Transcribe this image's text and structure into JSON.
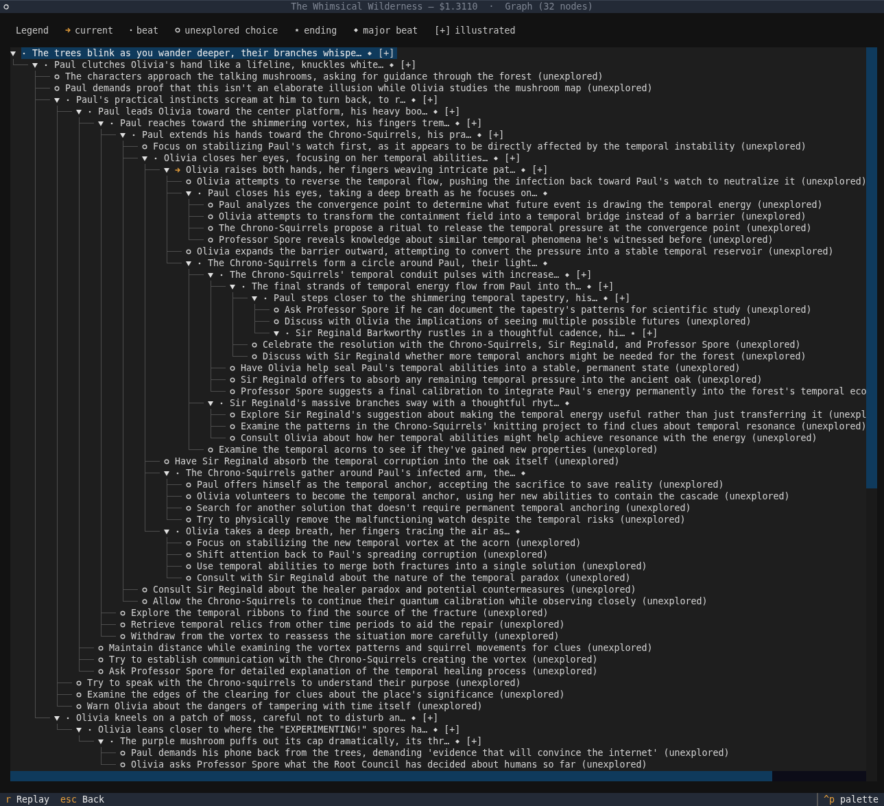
{
  "window": {
    "title": "The Whimsical Wilderness — $1.3110  ·  Graph (32 nodes)"
  },
  "legend": {
    "label": "Legend",
    "items": [
      {
        "kind": "current",
        "label": "current"
      },
      {
        "kind": "beat",
        "label": "beat"
      },
      {
        "kind": "choice",
        "label": "unexplored choice"
      },
      {
        "kind": "ending",
        "label": "ending"
      },
      {
        "kind": "major",
        "label": "major beat"
      },
      {
        "kind": "illustrated",
        "symbol": "[+]",
        "label": "illustrated"
      }
    ]
  },
  "tree": [
    {
      "kind": "beat",
      "expanded": true,
      "selected": true,
      "text": "The trees blink as you wander deeper, their branches whispe…",
      "major": true,
      "badge": "[+]",
      "children": [
        {
          "kind": "beat",
          "expanded": true,
          "selected": false,
          "text": "Paul clutches Olivia's hand like a lifeline, knuckles white…",
          "major": true,
          "badge": "[+]",
          "children": [
            {
              "kind": "choice",
              "selected": false,
              "text": "The characters approach the talking mushrooms, asking for guidance through the forest (unexplored)"
            },
            {
              "kind": "choice",
              "selected": false,
              "text": "Paul demands proof that this isn't an elaborate illusion while Olivia studies the mushroom map (unexplored)"
            },
            {
              "kind": "beat",
              "expanded": true,
              "selected": false,
              "text": "Paul's practical instincts scream at him to turn back, to r…",
              "major": true,
              "badge": "[+]",
              "children": [
                {
                  "kind": "beat",
                  "expanded": true,
                  "selected": false,
                  "text": "Paul leads Olivia toward the center platform, his heavy boo…",
                  "major": true,
                  "badge": "[+]",
                  "children": [
                    {
                      "kind": "beat",
                      "expanded": true,
                      "selected": false,
                      "text": "Paul reaches toward the shimmering vortex, his fingers trem…",
                      "major": true,
                      "badge": "[+]",
                      "children": [
                        {
                          "kind": "beat",
                          "expanded": true,
                          "selected": false,
                          "text": "Paul extends his hands toward the Chrono-Squirrels, his pra…",
                          "major": true,
                          "badge": "[+]",
                          "children": [
                            {
                              "kind": "choice",
                              "selected": false,
                              "text": "Focus on stabilizing Paul's watch first, as it appears to be directly affected by the temporal instability (unexplored)"
                            },
                            {
                              "kind": "beat",
                              "expanded": true,
                              "selected": false,
                              "text": "Olivia closes her eyes, focusing on her temporal abilities…",
                              "major": true,
                              "badge": "[+]",
                              "children": [
                                {
                                  "kind": "current",
                                  "expanded": true,
                                  "selected": false,
                                  "text": "Olivia raises both hands, her fingers weaving intricate pat…",
                                  "major": true,
                                  "badge": "[+]",
                                  "children": [
                                    {
                                      "kind": "choice",
                                      "selected": false,
                                      "text": "Olivia attempts to reverse the temporal flow, pushing the infection back toward Paul's watch to neutralize it (unexplored)"
                                    },
                                    {
                                      "kind": "beat",
                                      "expanded": true,
                                      "selected": false,
                                      "text": "Paul closes his eyes, taking a deep breath as he focuses on…",
                                      "major": true,
                                      "children": [
                                        {
                                          "kind": "choice",
                                          "selected": false,
                                          "text": "Paul analyzes the convergence point to determine what future event is drawing the temporal energy (unexplored)"
                                        },
                                        {
                                          "kind": "choice",
                                          "selected": false,
                                          "text": "Olivia attempts to transform the containment field into a temporal bridge instead of a barrier (unexplored)"
                                        },
                                        {
                                          "kind": "choice",
                                          "selected": false,
                                          "text": "The Chrono-Squirrels propose a ritual to release the temporal pressure at the convergence point (unexplored)"
                                        },
                                        {
                                          "kind": "choice",
                                          "selected": false,
                                          "text": "Professor Spore reveals knowledge about similar temporal phenomena he's witnessed before (unexplored)"
                                        }
                                      ]
                                    },
                                    {
                                      "kind": "choice",
                                      "selected": false,
                                      "text": "Olivia expands the barrier outward, attempting to convert the pressure into a stable temporal reservoir (unexplored)"
                                    },
                                    {
                                      "kind": "beat",
                                      "expanded": true,
                                      "selected": false,
                                      "text": "The Chrono-Squirrels form a circle around Paul, their light…",
                                      "major": true,
                                      "children": [
                                        {
                                          "kind": "beat",
                                          "expanded": true,
                                          "selected": false,
                                          "text": "The Chrono-Squirrels' temporal conduit pulses with increase…",
                                          "major": true,
                                          "badge": "[+]",
                                          "children": [
                                            {
                                              "kind": "beat",
                                              "expanded": true,
                                              "selected": false,
                                              "text": "The final strands of temporal energy flow from Paul into th…",
                                              "major": true,
                                              "badge": "[+]",
                                              "children": [
                                                {
                                                  "kind": "beat",
                                                  "expanded": true,
                                                  "selected": false,
                                                  "text": "Paul steps closer to the shimmering temporal tapestry, his…",
                                                  "major": true,
                                                  "badge": "[+]",
                                                  "children": [
                                                    {
                                                      "kind": "choice",
                                                      "selected": false,
                                                      "text": "Ask Professor Spore if he can document the tapestry's patterns for scientific study (unexplored)"
                                                    },
                                                    {
                                                      "kind": "choice",
                                                      "selected": false,
                                                      "text": "Discuss with Olivia the implications of seeing multiple possible futures (unexplored)"
                                                    },
                                                    {
                                                      "kind": "beat",
                                                      "expanded": true,
                                                      "selected": false,
                                                      "text": "Sir Reginald Barkworthy rustles in a thoughtful cadence, hi…",
                                                      "ending": true,
                                                      "badge": "[+]"
                                                    }
                                                  ]
                                                },
                                                {
                                                  "kind": "choice",
                                                  "selected": false,
                                                  "text": "Celebrate the resolution with the Chrono-Squirrels, Sir Reginald, and Professor Spore (unexplored)"
                                                },
                                                {
                                                  "kind": "choice",
                                                  "selected": false,
                                                  "text": "Discuss with Sir Reginald whether more temporal anchors might be needed for the forest (unexplored)"
                                                }
                                              ]
                                            },
                                            {
                                              "kind": "choice",
                                              "selected": false,
                                              "text": "Have Olivia help seal Paul's temporal abilities into a stable, permanent state (unexplored)"
                                            },
                                            {
                                              "kind": "choice",
                                              "selected": false,
                                              "text": "Sir Reginald offers to absorb any remaining temporal pressure into the ancient oak (unexplored)"
                                            },
                                            {
                                              "kind": "choice",
                                              "selected": false,
                                              "text": "Professor Spore suggests a final calibration to integrate Paul's energy permanently into the forest's temporal eco"
                                            }
                                          ]
                                        },
                                        {
                                          "kind": "beat",
                                          "expanded": true,
                                          "selected": false,
                                          "text": "Sir Reginald's massive branches sway with a thoughtful rhyt…",
                                          "major": true,
                                          "children": [
                                            {
                                              "kind": "choice",
                                              "selected": false,
                                              "text": "Explore Sir Reginald's suggestion about making the temporal energy useful rather than just transferring it (unexpl"
                                            },
                                            {
                                              "kind": "choice",
                                              "selected": false,
                                              "text": "Examine the patterns in the Chrono-Squirrels' knitting project to find clues about temporal resonance (unexplored)"
                                            },
                                            {
                                              "kind": "choice",
                                              "selected": false,
                                              "text": "Consult Olivia about how her temporal abilities might help achieve resonance with the energy (unexplored)"
                                            }
                                          ]
                                        },
                                        {
                                          "kind": "choice",
                                          "selected": false,
                                          "text": "Examine the temporal acorns to see if they've gained new properties (unexplored)"
                                        }
                                      ]
                                    }
                                  ]
                                },
                                {
                                  "kind": "choice",
                                  "selected": false,
                                  "text": "Have Sir Reginald absorb the temporal corruption into the oak itself (unexplored)"
                                },
                                {
                                  "kind": "beat",
                                  "expanded": true,
                                  "selected": false,
                                  "text": "The Chrono-Squirrels gather around Paul's infected arm, the…",
                                  "major": true,
                                  "children": [
                                    {
                                      "kind": "choice",
                                      "selected": false,
                                      "text": "Paul offers himself as the temporal anchor, accepting the sacrifice to save reality (unexplored)"
                                    },
                                    {
                                      "kind": "choice",
                                      "selected": false,
                                      "text": "Olivia volunteers to become the temporal anchor, using her new abilities to contain the cascade (unexplored)"
                                    },
                                    {
                                      "kind": "choice",
                                      "selected": false,
                                      "text": "Search for another solution that doesn't require permanent temporal anchoring (unexplored)"
                                    },
                                    {
                                      "kind": "choice",
                                      "selected": false,
                                      "text": "Try to physically remove the malfunctioning watch despite the temporal risks (unexplored)"
                                    }
                                  ]
                                },
                                {
                                  "kind": "beat",
                                  "expanded": true,
                                  "selected": false,
                                  "text": "Olivia takes a deep breath, her fingers tracing the air as…",
                                  "major": true,
                                  "children": [
                                    {
                                      "kind": "choice",
                                      "selected": false,
                                      "text": "Focus on stabilizing the new temporal vortex at the acorn (unexplored)"
                                    },
                                    {
                                      "kind": "choice",
                                      "selected": false,
                                      "text": "Shift attention back to Paul's spreading corruption (unexplored)"
                                    },
                                    {
                                      "kind": "choice",
                                      "selected": false,
                                      "text": "Use temporal abilities to merge both fractures into a single solution (unexplored)"
                                    },
                                    {
                                      "kind": "choice",
                                      "selected": false,
                                      "text": "Consult with Sir Reginald about the nature of the temporal paradox (unexplored)"
                                    }
                                  ]
                                }
                              ]
                            },
                            {
                              "kind": "choice",
                              "selected": false,
                              "text": "Consult Sir Reginald about the healer paradox and potential countermeasures (unexplored)"
                            },
                            {
                              "kind": "choice",
                              "selected": false,
                              "text": "Allow the Chrono-Squirrels to continue their quantum calibration while observing closely (unexplored)"
                            }
                          ]
                        },
                        {
                          "kind": "choice",
                          "selected": false,
                          "text": "Explore the temporal ribbons to find the source of the fracture (unexplored)"
                        },
                        {
                          "kind": "choice",
                          "selected": false,
                          "text": "Retrieve temporal relics from other time periods to aid the repair (unexplored)"
                        },
                        {
                          "kind": "choice",
                          "selected": false,
                          "text": "Withdraw from the vortex to reassess the situation more carefully (unexplored)"
                        }
                      ]
                    },
                    {
                      "kind": "choice",
                      "selected": false,
                      "text": "Maintain distance while examining the vortex patterns and squirrel movements for clues (unexplored)"
                    },
                    {
                      "kind": "choice",
                      "selected": false,
                      "text": "Try to establish communication with the Chrono-Squirrels creating the vortex (unexplored)"
                    },
                    {
                      "kind": "choice",
                      "selected": false,
                      "text": "Ask Professor Spore for detailed explanation of the temporal healing process (unexplored)"
                    }
                  ]
                },
                {
                  "kind": "choice",
                  "selected": false,
                  "text": "Try to speak with the Chrono-squirrels to understand their purpose (unexplored)"
                },
                {
                  "kind": "choice",
                  "selected": false,
                  "text": "Examine the edges of the clearing for clues about the place's significance (unexplored)"
                },
                {
                  "kind": "choice",
                  "selected": false,
                  "text": "Warn Olivia about the dangers of tampering with time itself (unexplored)"
                }
              ]
            },
            {
              "kind": "beat",
              "expanded": true,
              "selected": false,
              "text": "Olivia kneels on a patch of moss, careful not to disturb an…",
              "major": true,
              "badge": "[+]",
              "children": [
                {
                  "kind": "beat",
                  "expanded": true,
                  "selected": false,
                  "text": "Olivia leans closer to where the \"EXPERIMENTING!\" spores ha…",
                  "major": true,
                  "badge": "[+]",
                  "children": [
                    {
                      "kind": "beat",
                      "expanded": true,
                      "selected": false,
                      "text": "The purple mushroom puffs out its cap dramatically, its thr…",
                      "major": true,
                      "badge": "[+]",
                      "children": [
                        {
                          "kind": "choice",
                          "selected": false,
                          "text": "Paul demands his phone back from the trees, demanding 'evidence that will convince the internet' (unexplored)"
                        },
                        {
                          "kind": "choice",
                          "selected": false,
                          "text": "Olivia asks Professor Spore what the Root Council has decided about humans so far (unexplored)"
                        }
                      ]
                    }
                  ]
                }
              ]
            }
          ]
        }
      ]
    }
  ],
  "status_bar": {
    "left": [
      {
        "key": "r",
        "label": "Replay"
      },
      {
        "key": "esc",
        "label": "Back"
      }
    ],
    "right": [
      {
        "key": "^p",
        "label": "palette"
      }
    ]
  }
}
